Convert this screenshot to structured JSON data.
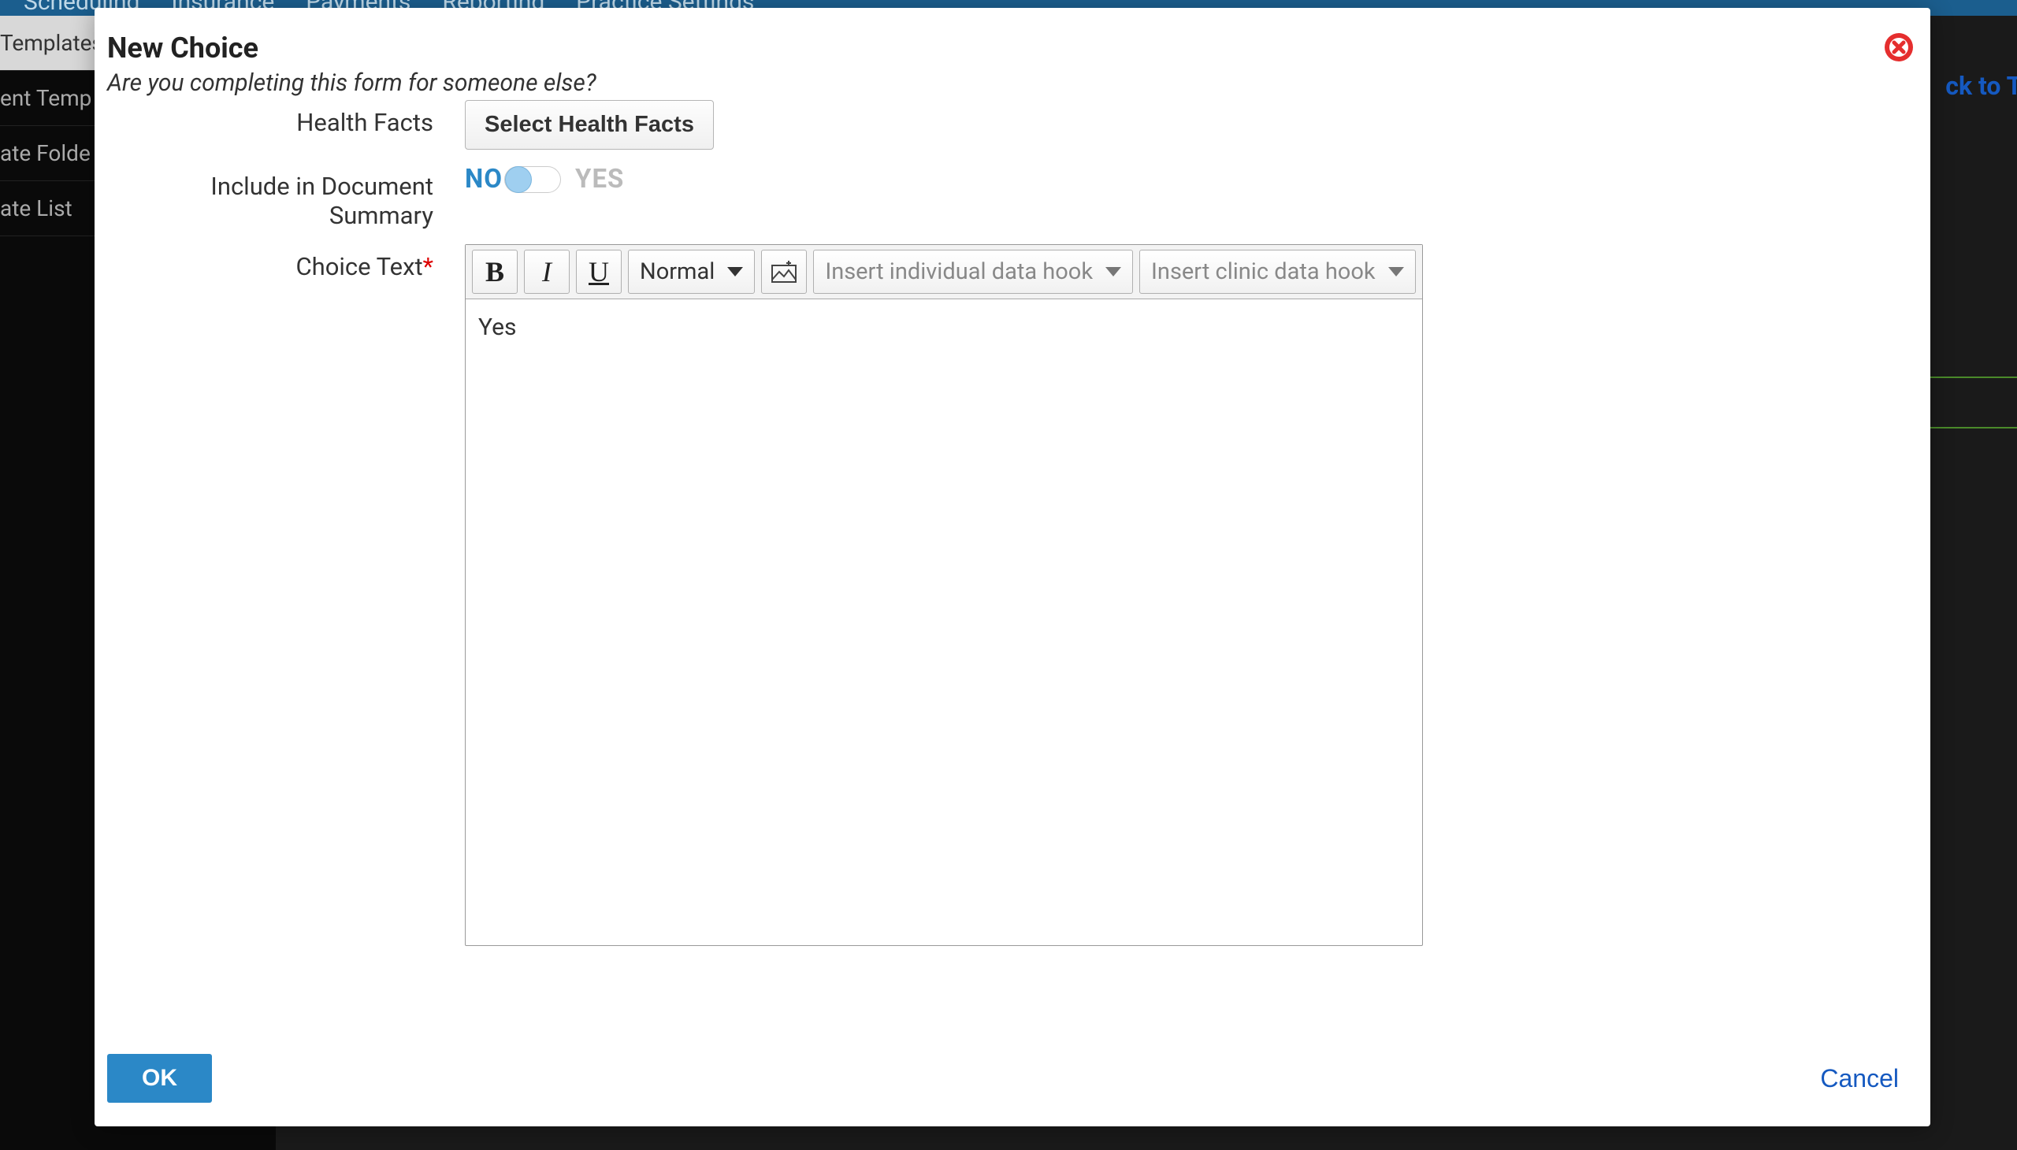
{
  "bg_nav": {
    "items": [
      "Scheduling",
      "Insurance",
      "Payments",
      "Reporting",
      "Practice Settings"
    ]
  },
  "bg_sidebar": {
    "items": [
      "Templates",
      "ent Temp",
      "ate Folde",
      "ate List"
    ]
  },
  "bg_backlink": "ck to Tem",
  "modal": {
    "title": "New Choice",
    "subtitle": "Are you completing this form for someone else?",
    "labels": {
      "health_facts": "Health Facts",
      "include_summary": "Include in Document Summary",
      "choice_text": "Choice Text"
    },
    "health_facts_button": "Select Health Facts",
    "toggle": {
      "no": "NO",
      "yes": "YES",
      "value": false
    },
    "editor": {
      "bold": "B",
      "italic": "I",
      "underline": "U",
      "format_select": "Normal",
      "individual_hook": "Insert individual data hook",
      "clinic_hook": "Insert clinic data hook",
      "content": "Yes"
    },
    "footer": {
      "ok": "OK",
      "cancel": "Cancel"
    }
  }
}
